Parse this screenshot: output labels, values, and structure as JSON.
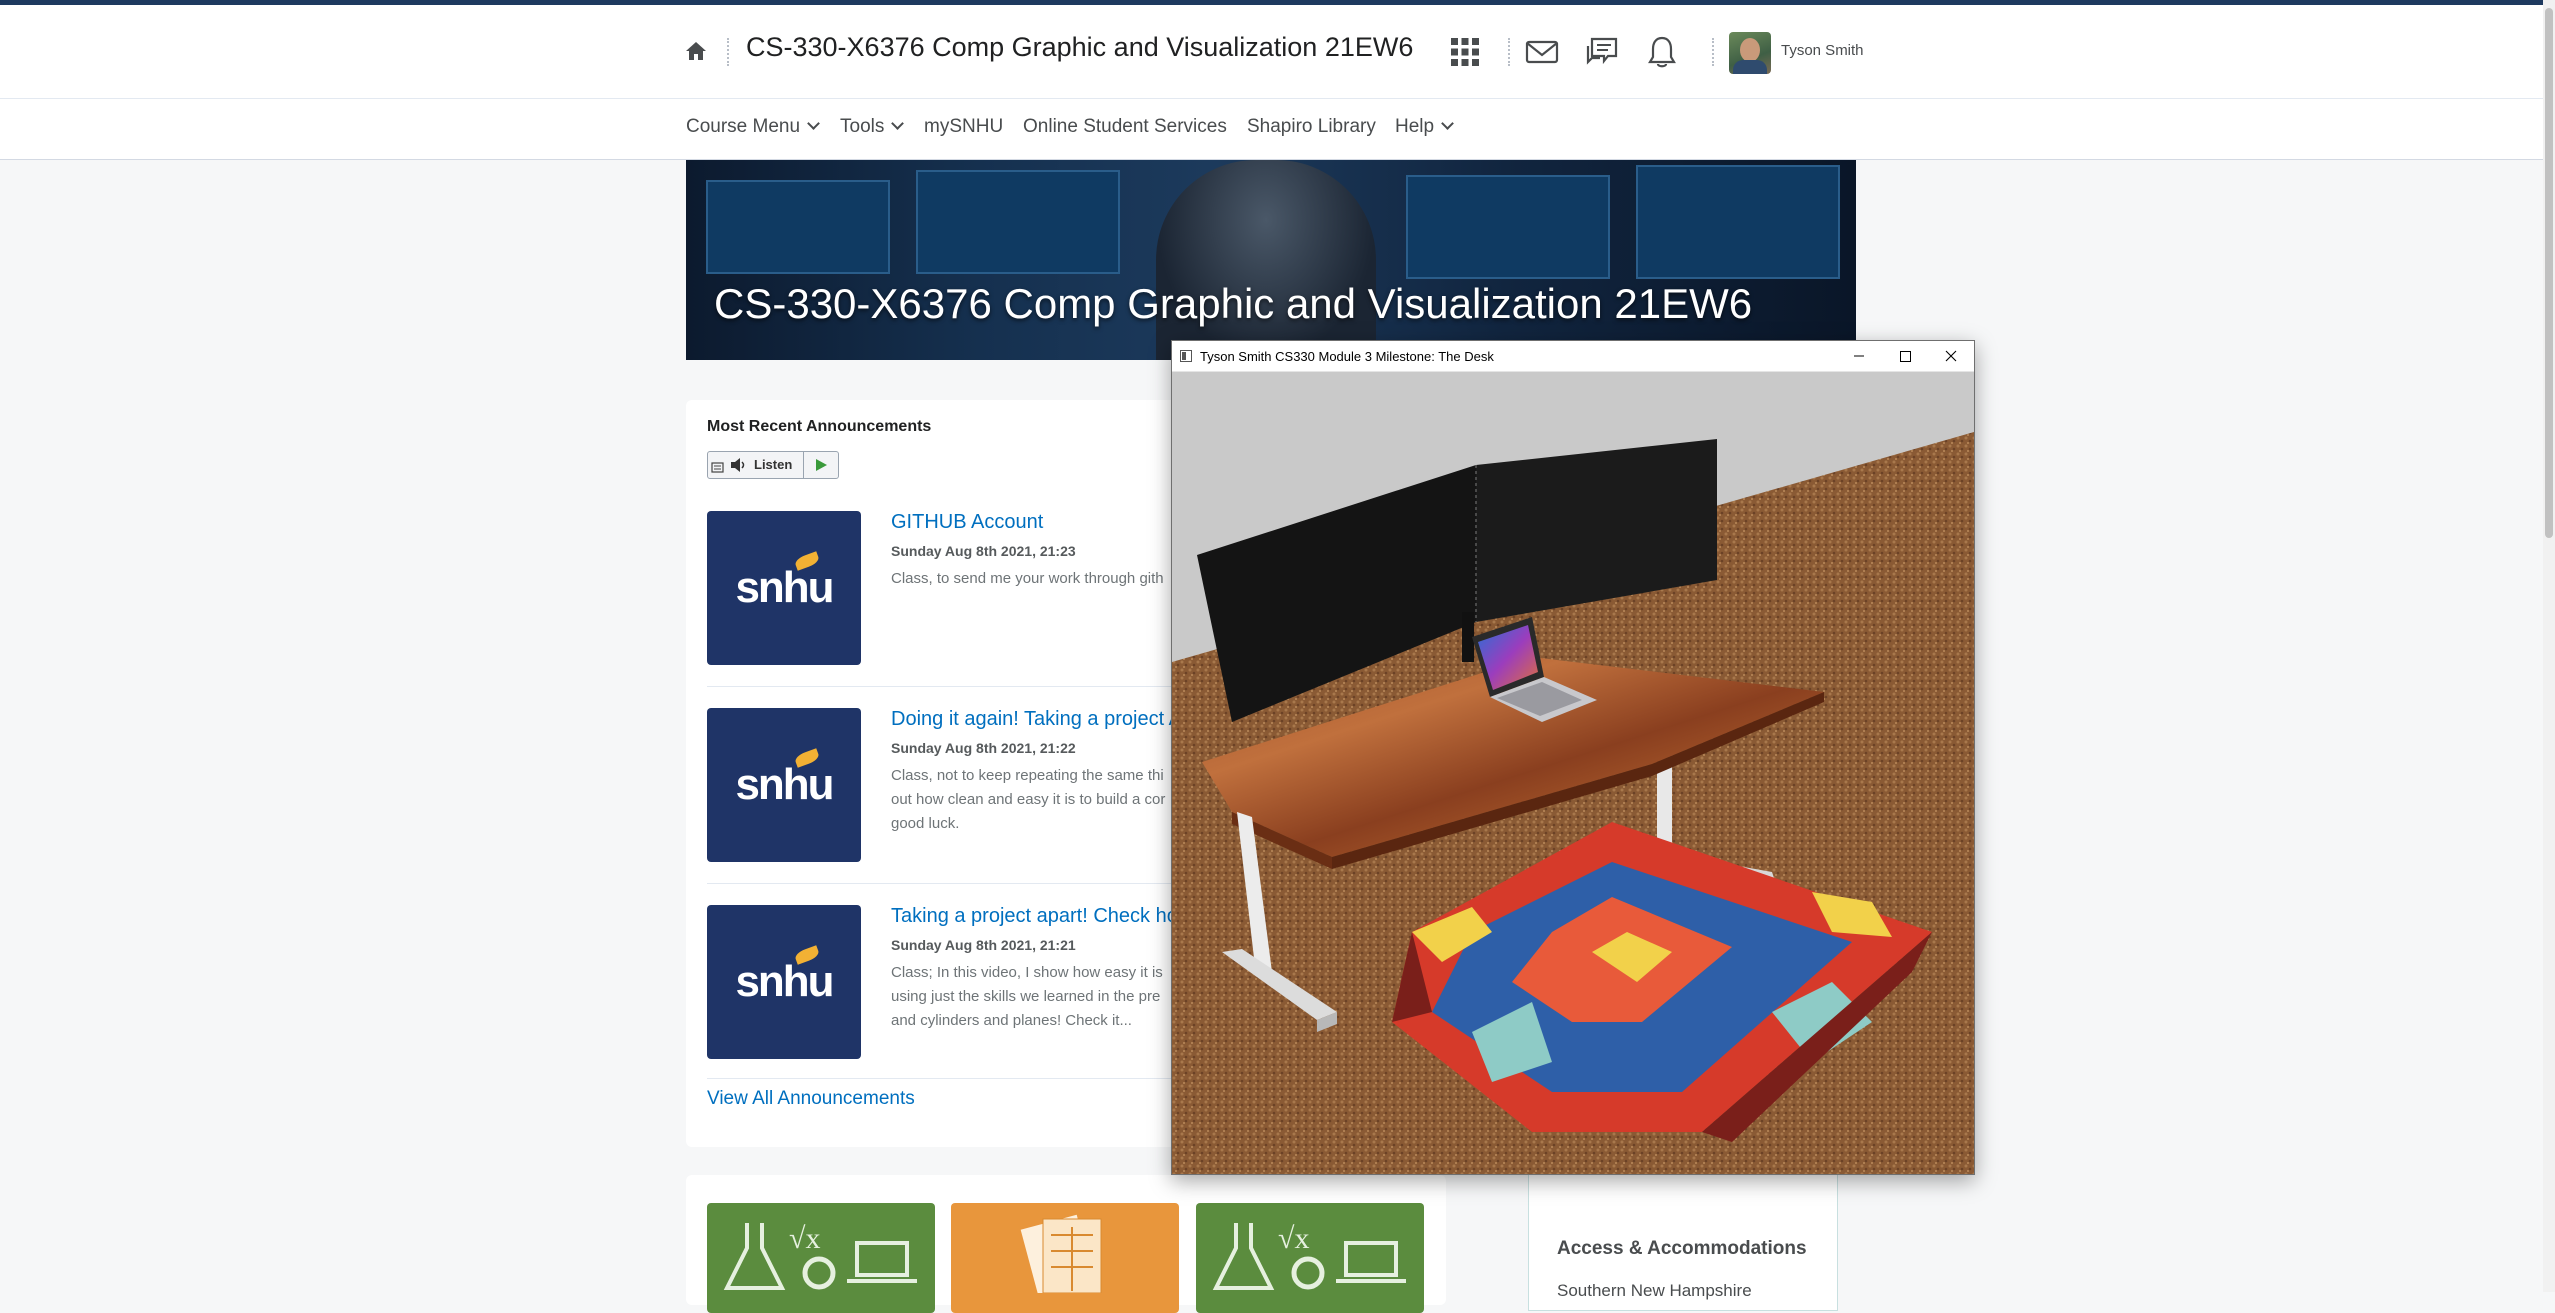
{
  "header": {
    "course_title": "CS-330-X6376 Comp Graphic and Visualization 21EW6",
    "user_name": "Tyson Smith",
    "icons": [
      "home-icon",
      "apps-grid-icon",
      "mail-icon",
      "chat-icon",
      "bell-icon"
    ]
  },
  "nav": {
    "items": [
      {
        "label": "Course Menu",
        "dropdown": true
      },
      {
        "label": "Tools",
        "dropdown": true
      },
      {
        "label": "mySNHU",
        "dropdown": false
      },
      {
        "label": "Online Student Services",
        "dropdown": false
      },
      {
        "label": "Shapiro Library",
        "dropdown": false
      },
      {
        "label": "Help",
        "dropdown": true
      }
    ]
  },
  "banner": {
    "title": "CS-330-X6376 Comp Graphic and Visualization 21EW6"
  },
  "announcements": {
    "heading": "Most Recent Announcements",
    "listen_label": "Listen",
    "logo_text": "snhu",
    "items": [
      {
        "title": "GITHUB Account",
        "date": "Sunday Aug 8th 2021, 21:23",
        "lines": [
          "Class, to send me your work through gith"
        ]
      },
      {
        "title": "Doing it again! Taking a project A",
        "date": "Sunday Aug 8th 2021, 21:22",
        "lines": [
          "Class, not to keep repeating the same thi",
          "out how clean and easy it is to build a cor",
          "good luck."
        ]
      },
      {
        "title": "Taking a project apart! Check ho",
        "date": "Sunday Aug 8th 2021, 21:21",
        "lines": [
          "Class; In this video, I show how easy it is",
          "using just the skills we learned in the pre",
          "and cylinders and planes! Check it..."
        ]
      }
    ],
    "view_all": "View All Announcements"
  },
  "sidebar_widget": {
    "heading": "Access & Accommodations",
    "subtext": "Southern New Hampshire"
  },
  "app_window": {
    "title": "Tyson Smith CS330 Module 3 Milestone: The Desk",
    "controls": [
      "minimize",
      "maximize",
      "close"
    ]
  },
  "colors": {
    "link": "#006fbf",
    "brand_navy": "#1f3467",
    "brand_gold": "#f2b134",
    "tile_green": "#5b8c3e",
    "tile_orange": "#e8963c"
  }
}
